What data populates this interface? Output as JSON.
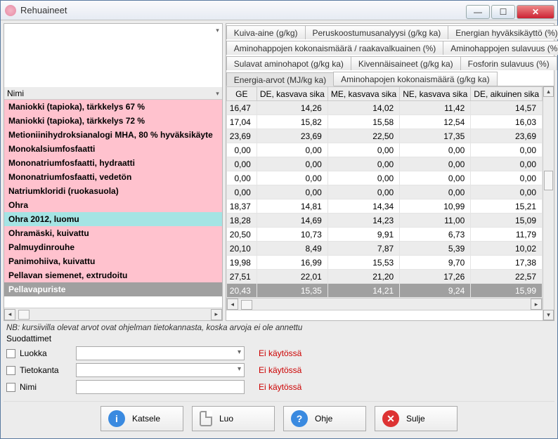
{
  "window": {
    "title": "Rehuaineet",
    "note": "NB: kursiivilla olevat arvot ovat ohjelman tietokannasta, koska arvoja ei ole annettu"
  },
  "leftHeader": "Nimi",
  "leftRows": [
    {
      "label": "Maniokki (tapioka), tärkkelys 67 %",
      "bg": "pink"
    },
    {
      "label": "Maniokki (tapioka), tärkkelys 72 %",
      "bg": "pink"
    },
    {
      "label": "Metioniinihydroksianalogi MHA, 80 % hyväksikäyte",
      "bg": "pink"
    },
    {
      "label": "Monokalsiumfosfaatti",
      "bg": "pink"
    },
    {
      "label": "Mononatriumfosfaatti, hydraatti",
      "bg": "pink"
    },
    {
      "label": "Mononatriumfosfaatti, vedetön",
      "bg": "pink"
    },
    {
      "label": "Natriumkloridi (ruokasuola)",
      "bg": "pink"
    },
    {
      "label": "Ohra",
      "bg": "pink"
    },
    {
      "label": "Ohra 2012, luomu",
      "bg": "teal"
    },
    {
      "label": "Ohramäski, kuivattu",
      "bg": "pink"
    },
    {
      "label": "Palmuydinrouhe",
      "bg": "pink"
    },
    {
      "label": "Panimohiiva, kuivattu",
      "bg": "pink"
    },
    {
      "label": "Pellavan siemenet, extrudoitu",
      "bg": "pink"
    },
    {
      "label": "Pellavapuriste",
      "bg": "sel"
    }
  ],
  "tabs": {
    "row1": [
      "Kuiva-aine (g/kg)",
      "Peruskoostumusanalyysi (g/kg ka)",
      "Energian hyväksikäyttö (%)"
    ],
    "row2": [
      "Aminohappojen kokonaismäärä / raakavalkuainen (%)",
      "Aminohappojen sulavuus (%)"
    ],
    "row3": [
      "Sulavat aminohapot (g/kg ka)",
      "Kivennäisaineet (g/kg ka)",
      "Fosforin sulavuus (%)"
    ],
    "row4": [
      "Energia-arvot (MJ/kg ka)",
      "Aminohapojen kokonaismäärä (g/kg ka)"
    ]
  },
  "cols": [
    "GE",
    "DE, kasvava sika",
    "ME, kasvava sika",
    "NE, kasvava sika",
    "DE, aikuinen sika"
  ],
  "data": [
    [
      "16,47",
      "14,26",
      "14,02",
      "11,42",
      "14,57"
    ],
    [
      "17,04",
      "15,82",
      "15,58",
      "12,54",
      "16,03"
    ],
    [
      "23,69",
      "23,69",
      "22,50",
      "17,35",
      "23,69"
    ],
    [
      "0,00",
      "0,00",
      "0,00",
      "0,00",
      "0,00"
    ],
    [
      "0,00",
      "0,00",
      "0,00",
      "0,00",
      "0,00"
    ],
    [
      "0,00",
      "0,00",
      "0,00",
      "0,00",
      "0,00"
    ],
    [
      "0,00",
      "0,00",
      "0,00",
      "0,00",
      "0,00"
    ],
    [
      "18,37",
      "14,81",
      "14,34",
      "10,99",
      "15,21"
    ],
    [
      "18,28",
      "14,69",
      "14,23",
      "11,00",
      "15,09"
    ],
    [
      "20,50",
      "10,73",
      "9,91",
      "6,73",
      "11,79"
    ],
    [
      "20,10",
      "8,49",
      "7,87",
      "5,39",
      "10,02"
    ],
    [
      "19,98",
      "16,99",
      "15,53",
      "9,70",
      "17,38"
    ],
    [
      "27,51",
      "22,01",
      "21,20",
      "17,26",
      "22,57"
    ],
    [
      "20,43",
      "15,35",
      "14,21",
      "9,24",
      "15,99"
    ]
  ],
  "filters": {
    "label": "Suodattimet",
    "rows": [
      {
        "label": "Luokka",
        "combo": true,
        "status": "Ei käytössä"
      },
      {
        "label": "Tietokanta",
        "combo": true,
        "status": "Ei käytössä"
      },
      {
        "label": "Nimi",
        "combo": false,
        "status": "Ei käytössä"
      }
    ]
  },
  "buttons": {
    "view": "Katsele",
    "create": "Luo",
    "help": "Ohje",
    "close": "Sulje"
  }
}
